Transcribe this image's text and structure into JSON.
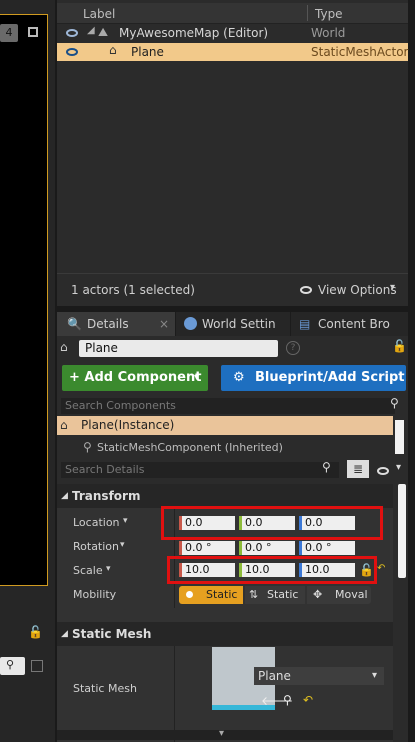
{
  "viewport": {
    "view_number": "4"
  },
  "outliner": {
    "col_label": "Label",
    "col_type": "Type",
    "rows": [
      {
        "label": "MyAwesomeMap (Editor)",
        "type": "World"
      },
      {
        "label": "Plane",
        "type": "StaticMeshActor"
      }
    ],
    "actor_count": "1 actors (1 selected)",
    "view_options": "View Options"
  },
  "tabs": [
    "Details",
    "World Settin",
    "Content Bro"
  ],
  "details": {
    "name_value": "Plane",
    "add_component": "+ Add Component",
    "blueprint_script": "Blueprint/Add Script",
    "search_components_placeholder": "Search Components",
    "root_component": "Plane(Instance)",
    "child_component": "StaticMeshComponent (Inherited)",
    "search_details_placeholder": "Search Details",
    "transform_section": "Transform",
    "location_label": "Location",
    "location": [
      "0.0",
      "0.0",
      "0.0"
    ],
    "rotation_label": "Rotation",
    "rotation": [
      "0.0 °",
      "0.0 °",
      "0.0 °"
    ],
    "scale_label": "Scale",
    "scale": [
      "10.0",
      "10.0",
      "10.0"
    ],
    "mobility_label": "Mobility",
    "mobility_options": [
      "Static",
      "Static",
      "Moval"
    ],
    "static_mesh_section": "Static Mesh",
    "static_mesh_label": "Static Mesh",
    "static_mesh_value": "Plane"
  }
}
